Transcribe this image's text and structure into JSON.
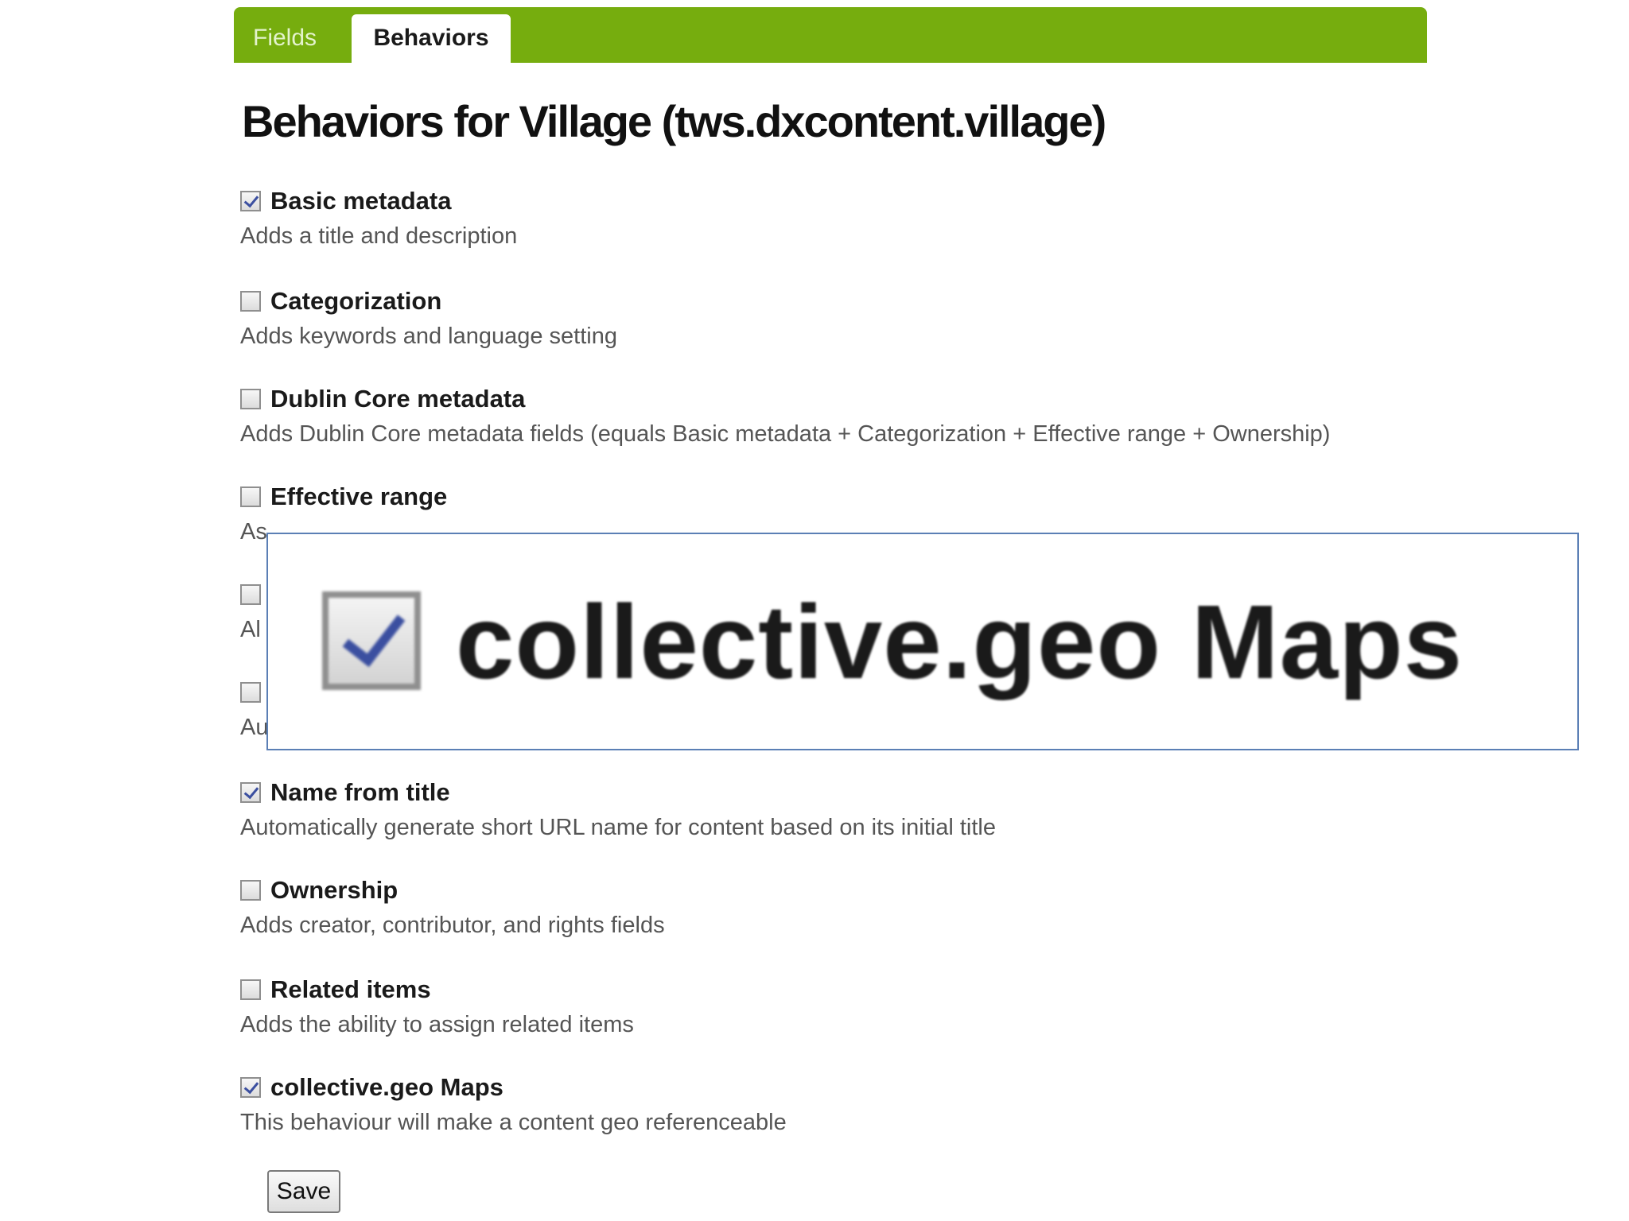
{
  "tabs": {
    "fields": "Fields",
    "behaviors": "Behaviors"
  },
  "heading": "Behaviors for Village (tws.dxcontent.village)",
  "behaviors": [
    {
      "label": "Basic metadata",
      "description": "Adds a title and description",
      "checked": true
    },
    {
      "label": "Categorization",
      "description": "Adds keywords and language setting",
      "checked": false
    },
    {
      "label": "Dublin Core metadata",
      "description": "Adds Dublin Core metadata fields (equals Basic metadata + Categorization + Effective range + Ownership)",
      "checked": false
    },
    {
      "label": "Effective range",
      "description": "As",
      "checked": false
    },
    {
      "label": "",
      "description": "Al",
      "checked": false
    },
    {
      "label": "",
      "description": "Au",
      "checked": false
    },
    {
      "label": "Name from title",
      "description": "Automatically generate short URL name for content based on its initial title",
      "checked": true
    },
    {
      "label": "Ownership",
      "description": "Adds creator, contributor, and rights fields",
      "checked": false
    },
    {
      "label": "Related items",
      "description": "Adds the ability to assign related items",
      "checked": false
    },
    {
      "label": "collective.geo Maps",
      "description": "This behaviour will make a content geo referenceable",
      "checked": true
    }
  ],
  "zoom": {
    "label": "collective.geo Maps",
    "checked": true
  },
  "save_label": "Save",
  "colors": {
    "tab_bar": "#76ad0e",
    "zoom_border": "#5b7fb5",
    "check": "#3b4fa0"
  }
}
